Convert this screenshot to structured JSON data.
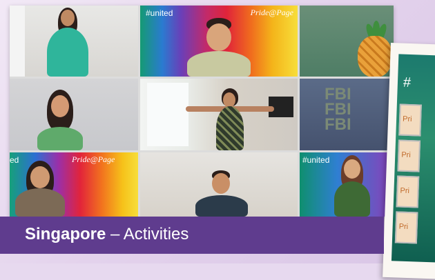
{
  "tiles": {
    "top_middle_hashtag": "#united",
    "top_middle_brand": "Pride@Page",
    "bottom_left_partial_hashtag": "ed",
    "bottom_left_brand": "Pride@Page",
    "bottom_right_hashtag": "#united",
    "shirt_print": "FBI FBI FBI"
  },
  "side_card": {
    "hashtag_partial": "#",
    "tag_text": "Pri"
  },
  "caption": {
    "location": "Singapore",
    "separator": " – ",
    "activity": "Activities"
  },
  "colors": {
    "caption_bg": "#5f3c8e",
    "page_bg": "#e7d9ef"
  }
}
